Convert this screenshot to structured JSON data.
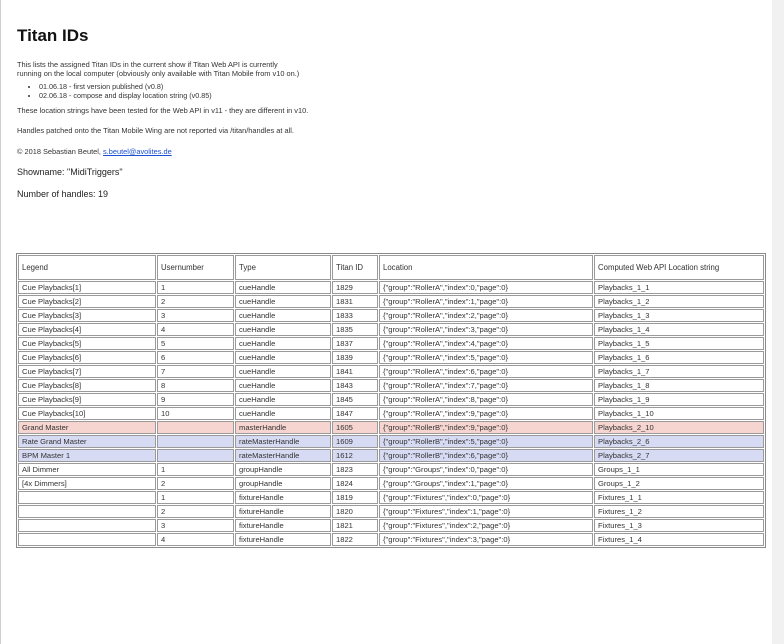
{
  "title": "Titan IDs",
  "intro_line1": "This lists the assigned Titan IDs in the current show if Titan Web API is currently",
  "intro_line2": "running on the local computer (obviously only available with Titan Mobile from v10 on.)",
  "changelog": [
    "01.06.18 - first version published (v0.8)",
    "02.06.18 - compose and display location string (v0.85)"
  ],
  "location_note": "These location strings have been tested for the Web API in v11 - they are different in v10.",
  "handles_note": "Handles patched onto the Titan Mobile Wing are not reported via /titan/handles at all.",
  "copyright_prefix": "© 2018 Sebastian Beutel, ",
  "author_email": "s.beutel@avolites.de",
  "showname": "Showname: \"MidiTriggers\"",
  "handle_count": "Number of handles: 19",
  "table": {
    "headers": [
      "Legend",
      "Usernumber",
      "Type",
      "Titan ID",
      "Location",
      "Computed Web API Location string"
    ],
    "rows": [
      {
        "legend": "Cue Playbacks[1]",
        "usernumber": "1",
        "type": "cueHandle",
        "titan_id": "1829",
        "location": "{\"group\":\"RollerA\",\"index\":0,\"page\":0}",
        "web_location": "Playbacks_1_1"
      },
      {
        "legend": "Cue Playbacks[2]",
        "usernumber": "2",
        "type": "cueHandle",
        "titan_id": "1831",
        "location": "{\"group\":\"RollerA\",\"index\":1,\"page\":0}",
        "web_location": "Playbacks_1_2"
      },
      {
        "legend": "Cue Playbacks[3]",
        "usernumber": "3",
        "type": "cueHandle",
        "titan_id": "1833",
        "location": "{\"group\":\"RollerA\",\"index\":2,\"page\":0}",
        "web_location": "Playbacks_1_3"
      },
      {
        "legend": "Cue Playbacks[4]",
        "usernumber": "4",
        "type": "cueHandle",
        "titan_id": "1835",
        "location": "{\"group\":\"RollerA\",\"index\":3,\"page\":0}",
        "web_location": "Playbacks_1_4"
      },
      {
        "legend": "Cue Playbacks[5]",
        "usernumber": "5",
        "type": "cueHandle",
        "titan_id": "1837",
        "location": "{\"group\":\"RollerA\",\"index\":4,\"page\":0}",
        "web_location": "Playbacks_1_5"
      },
      {
        "legend": "Cue Playbacks[6]",
        "usernumber": "6",
        "type": "cueHandle",
        "titan_id": "1839",
        "location": "{\"group\":\"RollerA\",\"index\":5,\"page\":0}",
        "web_location": "Playbacks_1_6"
      },
      {
        "legend": "Cue Playbacks[7]",
        "usernumber": "7",
        "type": "cueHandle",
        "titan_id": "1841",
        "location": "{\"group\":\"RollerA\",\"index\":6,\"page\":0}",
        "web_location": "Playbacks_1_7"
      },
      {
        "legend": "Cue Playbacks[8]",
        "usernumber": "8",
        "type": "cueHandle",
        "titan_id": "1843",
        "location": "{\"group\":\"RollerA\",\"index\":7,\"page\":0}",
        "web_location": "Playbacks_1_8"
      },
      {
        "legend": "Cue Playbacks[9]",
        "usernumber": "9",
        "type": "cueHandle",
        "titan_id": "1845",
        "location": "{\"group\":\"RollerA\",\"index\":8,\"page\":0}",
        "web_location": "Playbacks_1_9"
      },
      {
        "legend": "Cue Playbacks[10]",
        "usernumber": "10",
        "type": "cueHandle",
        "titan_id": "1847",
        "location": "{\"group\":\"RollerA\",\"index\":9,\"page\":0}",
        "web_location": "Playbacks_1_10"
      },
      {
        "legend": "Grand Master",
        "usernumber": "",
        "type": "masterHandle",
        "titan_id": "1605",
        "location": "{\"group\":\"RollerB\",\"index\":9,\"page\":0}",
        "web_location": "Playbacks_2_10",
        "highlight": "master"
      },
      {
        "legend": "Rate Grand Master",
        "usernumber": "",
        "type": "rateMasterHandle",
        "titan_id": "1609",
        "location": "{\"group\":\"RollerB\",\"index\":5,\"page\":0}",
        "web_location": "Playbacks_2_6",
        "highlight": "rate"
      },
      {
        "legend": "BPM Master 1",
        "usernumber": "",
        "type": "rateMasterHandle",
        "titan_id": "1612",
        "location": "{\"group\":\"RollerB\",\"index\":6,\"page\":0}",
        "web_location": "Playbacks_2_7",
        "highlight": "rate"
      },
      {
        "legend": "All Dimmer",
        "usernumber": "1",
        "type": "groupHandle",
        "titan_id": "1823",
        "location": "{\"group\":\"Groups\",\"index\":0,\"page\":0}",
        "web_location": "Groups_1_1"
      },
      {
        "legend": "[4x Dimmers]",
        "usernumber": "2",
        "type": "groupHandle",
        "titan_id": "1824",
        "location": "{\"group\":\"Groups\",\"index\":1,\"page\":0}",
        "web_location": "Groups_1_2"
      },
      {
        "legend": "",
        "usernumber": "1",
        "type": "fixtureHandle",
        "titan_id": "1819",
        "location": "{\"group\":\"Fixtures\",\"index\":0,\"page\":0}",
        "web_location": "Fixtures_1_1"
      },
      {
        "legend": "",
        "usernumber": "2",
        "type": "fixtureHandle",
        "titan_id": "1820",
        "location": "{\"group\":\"Fixtures\",\"index\":1,\"page\":0}",
        "web_location": "Fixtures_1_2"
      },
      {
        "legend": "",
        "usernumber": "3",
        "type": "fixtureHandle",
        "titan_id": "1821",
        "location": "{\"group\":\"Fixtures\",\"index\":2,\"page\":0}",
        "web_location": "Fixtures_1_3"
      },
      {
        "legend": "",
        "usernumber": "4",
        "type": "fixtureHandle",
        "titan_id": "1822",
        "location": "{\"group\":\"Fixtures\",\"index\":3,\"page\":0}",
        "web_location": "Fixtures_1_4"
      }
    ]
  },
  "colors": {
    "master_row": "#f6d5d1",
    "rate_row": "#d7daf3",
    "link": "#1a4fd6"
  }
}
